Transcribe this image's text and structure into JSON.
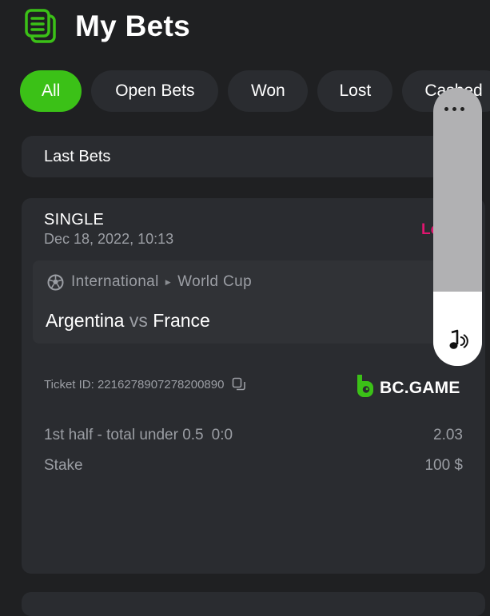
{
  "header": {
    "title": "My Bets",
    "icon": "bet-slip-icon",
    "icon_color": "#3bc117"
  },
  "filters": [
    {
      "label": "All",
      "active": true
    },
    {
      "label": "Open Bets",
      "active": false
    },
    {
      "label": "Won",
      "active": false
    },
    {
      "label": "Lost",
      "active": false
    },
    {
      "label": "Cashed",
      "active": false
    }
  ],
  "section": {
    "label": "Last Bets"
  },
  "bet": {
    "type": "SINGLE",
    "date": "Dec 18, 2022, 10:13",
    "status": "Lost",
    "status_color": "#e0156f",
    "league": {
      "sport_icon": "soccer-ball-icon",
      "category": "International",
      "tournament": "World Cup"
    },
    "match": {
      "home": "Argentina",
      "vs": "vs",
      "away": "France"
    },
    "ticket_label": "Ticket ID: 2216278907278200890",
    "brand": "BC.GAME",
    "market": "1st half - total under 0.5",
    "selection": "0:0",
    "odds": "2.03",
    "stake_label": "Stake",
    "stake_value": "100 $"
  },
  "colors": {
    "accent": "#3bc117",
    "background": "#1f2022",
    "card": "#2a2c30"
  }
}
